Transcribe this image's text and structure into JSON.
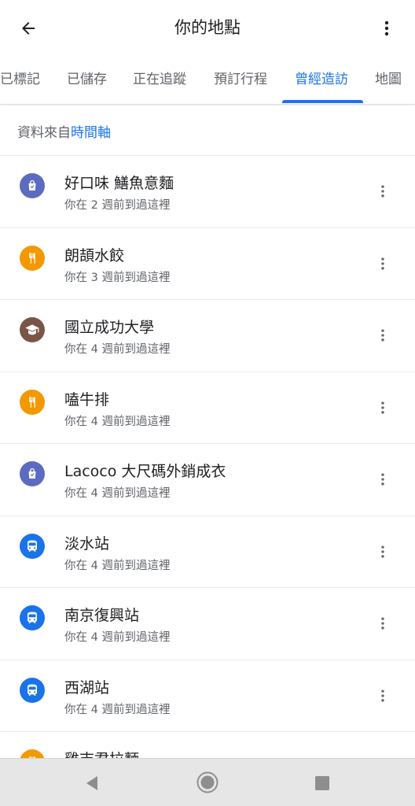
{
  "header": {
    "title": "你的地點",
    "back_icon": "arrow-back-icon",
    "more_icon": "more-vert-icon"
  },
  "tabs": [
    {
      "label": "已標記",
      "active": false
    },
    {
      "label": "已儲存",
      "active": false
    },
    {
      "label": "正在追蹤",
      "active": false
    },
    {
      "label": "預訂行程",
      "active": false
    },
    {
      "label": "曾經造訪",
      "active": true
    },
    {
      "label": "地圖",
      "active": false
    }
  ],
  "source": {
    "prefix": "資料來自",
    "link": "時間軸"
  },
  "colors": {
    "accent": "#1a73e8",
    "shopping": "#5c6bc0",
    "restaurant": "#f29900",
    "education": "#795548",
    "transit": "#1a73e8"
  },
  "places": [
    {
      "name": "好口味 鱔魚意麵",
      "visited": "你在 2 週前到過這裡",
      "category": "shopping",
      "icon": "shopping-bag-icon"
    },
    {
      "name": "朗頡水餃",
      "visited": "你在 3 週前到過這裡",
      "category": "restaurant",
      "icon": "fork-knife-icon"
    },
    {
      "name": "國立成功大學",
      "visited": "你在 4 週前到過這裡",
      "category": "education",
      "icon": "graduation-cap-icon"
    },
    {
      "name": "嗑牛排",
      "visited": "你在 4 週前到過這裡",
      "category": "restaurant",
      "icon": "fork-knife-icon"
    },
    {
      "name": "Lacoco 大尺碼外銷成衣",
      "visited": "你在 4 週前到過這裡",
      "category": "shopping",
      "icon": "shopping-bag-icon"
    },
    {
      "name": "淡水站",
      "visited": "你在 4 週前到過這裡",
      "category": "transit",
      "icon": "train-icon"
    },
    {
      "name": "南京復興站",
      "visited": "你在 4 週前到過這裡",
      "category": "transit",
      "icon": "train-icon"
    },
    {
      "name": "西湖站",
      "visited": "你在 4 週前到過這裡",
      "category": "transit",
      "icon": "train-icon"
    }
  ],
  "partial_place": {
    "name": "雞吉君拉麵",
    "category": "restaurant",
    "icon": "fork-knife-icon"
  },
  "navbar": {
    "back_icon": "nav-back-triangle-icon",
    "home_icon": "nav-home-circle-icon",
    "recent_icon": "nav-recent-square-icon"
  }
}
